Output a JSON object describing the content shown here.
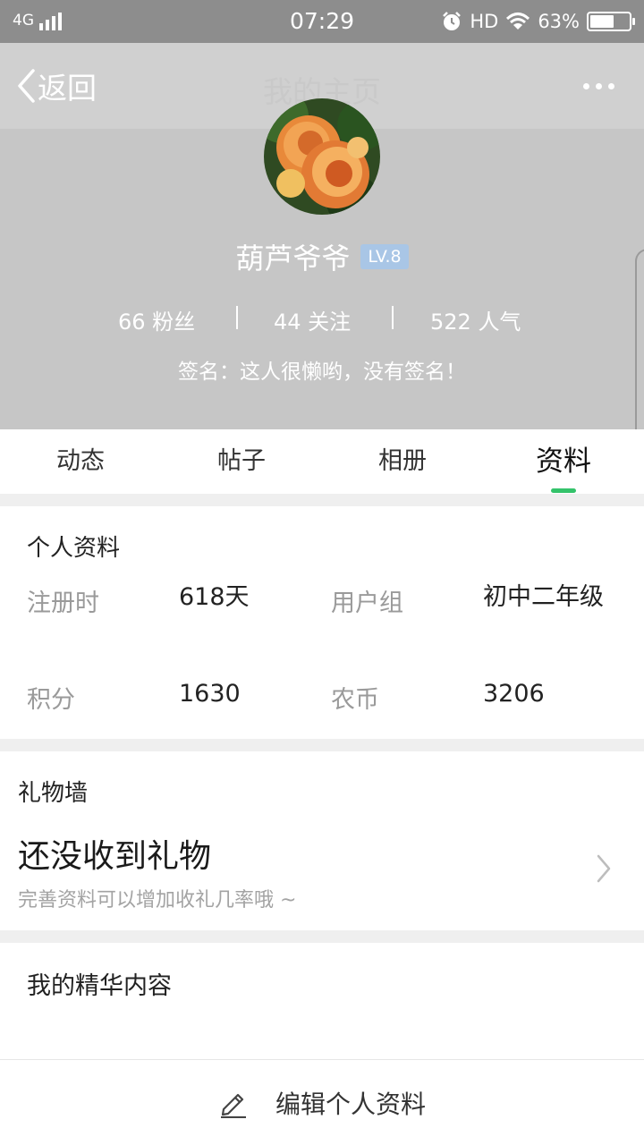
{
  "status_bar": {
    "network": "4G",
    "time": "07:29",
    "hd": "HD",
    "battery": "63%",
    "battery_level": 0.63
  },
  "nav": {
    "back_label": "返回",
    "title": "我的主页"
  },
  "profile": {
    "username": "葫芦爷爷",
    "level": "LV.8",
    "fans": "66 粉丝",
    "following": "44 关注",
    "popularity": "522 人气",
    "signature": "签名：这人很懒哟，没有签名！"
  },
  "tabs": [
    {
      "label": "动态"
    },
    {
      "label": "帖子"
    },
    {
      "label": "相册"
    },
    {
      "label": "资料"
    }
  ],
  "active_tab": "资料",
  "info": {
    "title": "个人资料",
    "register_label": "注册时",
    "register_value": "618天",
    "group_label": "用户组",
    "group_value": "初中二年级",
    "points_label": "积分",
    "points_value": "1630",
    "coins_label": "农币",
    "coins_value": "3206"
  },
  "gifts": {
    "title": "礼物墙",
    "empty": "还没收到礼物",
    "hint": "完善资料可以增加收礼几率哦 ~"
  },
  "featured": {
    "title": "我的精华内容"
  },
  "bottom": {
    "edit_label": "编辑个人资料"
  },
  "colors": {
    "accent": "#34c36b",
    "header_bg": "#c6c6c6",
    "level_badge": "#a9c6e6"
  }
}
